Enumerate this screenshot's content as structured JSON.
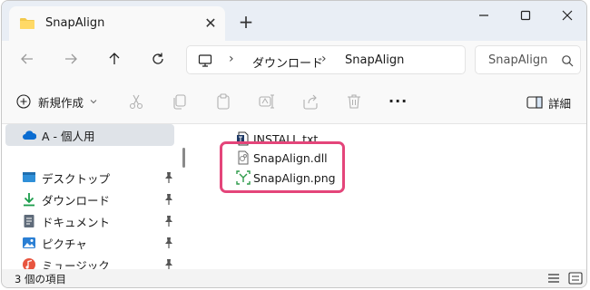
{
  "tab": {
    "title": "SnapAlign",
    "close_glyph": "✕",
    "new_tab_glyph": "+"
  },
  "window_controls": {
    "minimize": "—",
    "maximize": "□",
    "close": "✕"
  },
  "address": {
    "segments": [
      "ダウンロード",
      "SnapAlign"
    ],
    "separator": "›",
    "search_placeholder": "SnapAlign"
  },
  "toolbar": {
    "new_label": "新規作成",
    "more_label": "···",
    "details_label": "詳細"
  },
  "sidebar": {
    "items": [
      {
        "label": "A - 個人用",
        "icon": "cloud-icon",
        "pinned": false
      },
      {
        "label": "デスクトップ",
        "icon": "desktop-icon",
        "pinned": true
      },
      {
        "label": "ダウンロード",
        "icon": "download-icon",
        "pinned": true
      },
      {
        "label": "ドキュメント",
        "icon": "document-icon",
        "pinned": true
      },
      {
        "label": "ピクチャ",
        "icon": "picture-icon",
        "pinned": true
      },
      {
        "label": "ミュージック",
        "icon": "music-icon",
        "pinned": true
      }
    ]
  },
  "files": [
    {
      "name": "INSTALL.txt",
      "icon": "text-file-icon"
    },
    {
      "name": "SnapAlign.dll",
      "icon": "dll-file-icon"
    },
    {
      "name": "SnapAlign.png",
      "icon": "image-file-icon"
    }
  ],
  "status": {
    "item_count": "3 個の項目"
  },
  "colors": {
    "highlight": "#e4457a",
    "accent": "#0067c0"
  }
}
